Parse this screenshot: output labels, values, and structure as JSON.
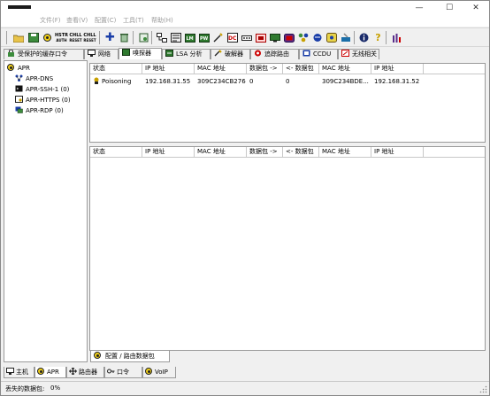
{
  "titlebar": {
    "minimize": "—",
    "maximize": "☐",
    "close": "✕"
  },
  "menu": [
    "文件(F)",
    "查看(V)",
    "配置(C)",
    "工具(T)",
    "帮助(H)"
  ],
  "toolbar": {
    "buttons": [
      "open",
      "save",
      "apr-start",
      "arp-scan",
      "chal-reset",
      "chal-reset-2",
      "add",
      "remove",
      "certificate",
      "trace",
      "hash",
      "ntlm",
      "pwd",
      "dsc",
      "lsa",
      "ciphers",
      "reset",
      "wireless",
      "voip",
      "config",
      "info",
      "help",
      "chart"
    ],
    "small_labels": {
      "hstr": "HSTR",
      "chal1": "CHLL",
      "chal2": "CHLL"
    }
  },
  "top_tabs": [
    {
      "label": "受保护的缓存口令",
      "icon": "lock-icon"
    },
    {
      "label": "网络",
      "icon": "network-icon"
    },
    {
      "label": "嗅探器",
      "icon": "sniffer-icon",
      "active": true
    },
    {
      "label": "LSA 分析",
      "icon": "lsa-icon"
    },
    {
      "label": "破解器",
      "icon": "cracker-icon"
    },
    {
      "label": "追踪路由",
      "icon": "traceroute-icon"
    },
    {
      "label": "CCDU",
      "icon": "ccdu-icon"
    },
    {
      "label": "无线相关",
      "icon": "wireless-icon"
    }
  ],
  "tree": {
    "root": "APR",
    "children": [
      "APR-DNS",
      "APR-SSH-1 (0)",
      "APR-HTTPS (0)",
      "APR-RDP (0)"
    ]
  },
  "grid_columns": [
    "状态",
    "IP 地址",
    "MAC 地址",
    "数据包 ->",
    "<- 数据包",
    "MAC 地址",
    "IP 地址"
  ],
  "top_grid_rows": [
    [
      "Poisoning",
      "192.168.31.55",
      "309C234CB276",
      "0",
      "0",
      "309C234BDE...",
      "192.168.31.52"
    ]
  ],
  "sub_tab": "配置 / 路由数据包",
  "bottom_tabs": [
    "主机",
    "APR",
    "路由器",
    "口令",
    "VoIP"
  ],
  "status": {
    "label": "丢失的数据包:",
    "value": "0%"
  },
  "colors": {
    "nuke_yellow": "#f3d21a",
    "grey_menu": "#9a9a9a"
  }
}
